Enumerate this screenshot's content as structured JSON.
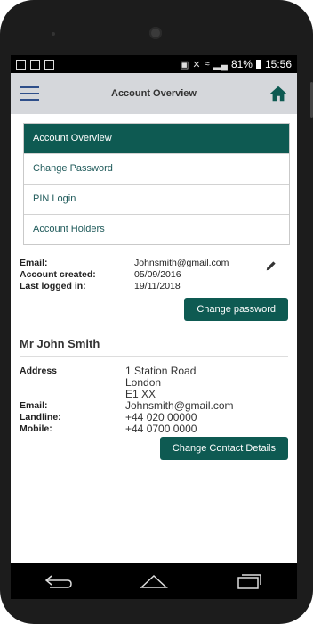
{
  "status_bar": {
    "battery": "81%",
    "time": "15:56"
  },
  "app_bar": {
    "title": "Account Overview",
    "menu_icon": "hamburger-menu-icon",
    "home_icon": "home-icon"
  },
  "nav": {
    "items": [
      {
        "label": "Account Overview",
        "active": true
      },
      {
        "label": "Change Password",
        "active": false
      },
      {
        "label": "PIN Login",
        "active": false
      },
      {
        "label": "Account Holders",
        "active": false
      }
    ]
  },
  "account": {
    "email_label": "Email:",
    "email": "Johnsmith@gmail.com",
    "created_label": "Account created:",
    "created": "05/09/2016",
    "last_login_label": "Last logged in:",
    "last_login": "19/11/2018",
    "change_password_button": "Change password"
  },
  "contact": {
    "name": "Mr John Smith",
    "address_label": "Address",
    "address_line1": "1 Station Road",
    "address_line2": "London",
    "address_line3": "E1 XX",
    "email_label": "Email:",
    "email": "Johnsmith@gmail.com",
    "landline_label": "Landline:",
    "landline": "+44 020 00000",
    "mobile_label": "Mobile:",
    "mobile": "+44 0700 0000",
    "change_contact_button": "Change Contact Details"
  },
  "colors": {
    "primary": "#0e5a52",
    "appbar": "#d5d7db",
    "menu_icon": "#2f4f8a"
  }
}
